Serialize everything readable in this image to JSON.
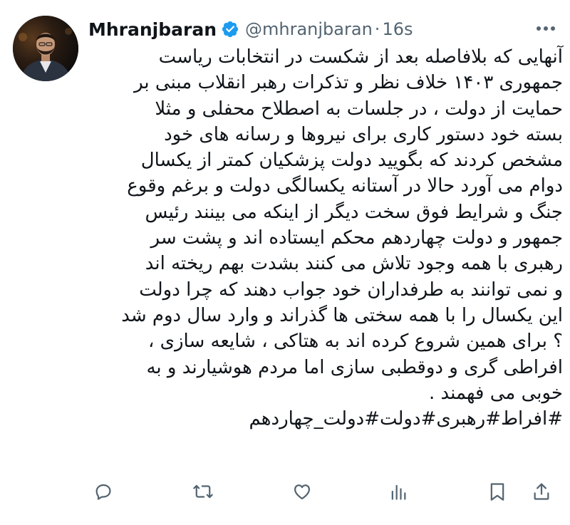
{
  "author": {
    "display_name": "Mhranjbaran",
    "handle": "@mhranjbaran",
    "separator": "·",
    "time": "16s",
    "verified_icon": "verified-badge-icon"
  },
  "tweet": {
    "lines": [
      "آنهایی که بلافاصله بعد از شکست در انتخابات ریاست",
      "جمهوری ۱۴۰۳ خلاف نظر و تذکرات رهبر انقلاب مبنی بر",
      "حمایت از دولت ، در جلسات به اصطلاح محفلی و مثلا",
      "بسته خود دستور کاری برای نیروها و رسانه های خود",
      "مشخص کردند که بگویید دولت پزشکیان کمتر از یکسال",
      "دوام می آورد حالا در آستانه یکسالگی دولت و برغم وقوع",
      "جنگ و شرایط فوق سخت دیگر از اینکه می بینند  رئیس",
      "جمهور و دولت چهاردهم محکم ایستاده اند و پشت سر",
      "رهبری با همه وجود تلاش می کنند بشدت بهم ریخته اند",
      "و نمی توانند به طرفداران خود جواب دهند که چرا دولت",
      "این یکسال را با همه سختی ها گذراند و وارد سال دوم شد",
      "؟ برای همین شروع کرده اند به هتاکی ، شایعه سازی ،",
      "افراطی گری و دوقطبی سازی اما مردم هوشیارند و به",
      "خوبی می فهمند .",
      "#افراط#رهبری#دولت#دولت_چهاردهم"
    ]
  },
  "actions": {
    "reply_icon": "reply-icon",
    "retweet_icon": "retweet-icon",
    "like_icon": "like-icon",
    "views_icon": "views-icon",
    "bookmark_icon": "bookmark-icon",
    "share_icon": "share-icon"
  },
  "colors": {
    "text": "#0f1419",
    "secondary": "#536471",
    "verified": "#1d9bf0"
  }
}
